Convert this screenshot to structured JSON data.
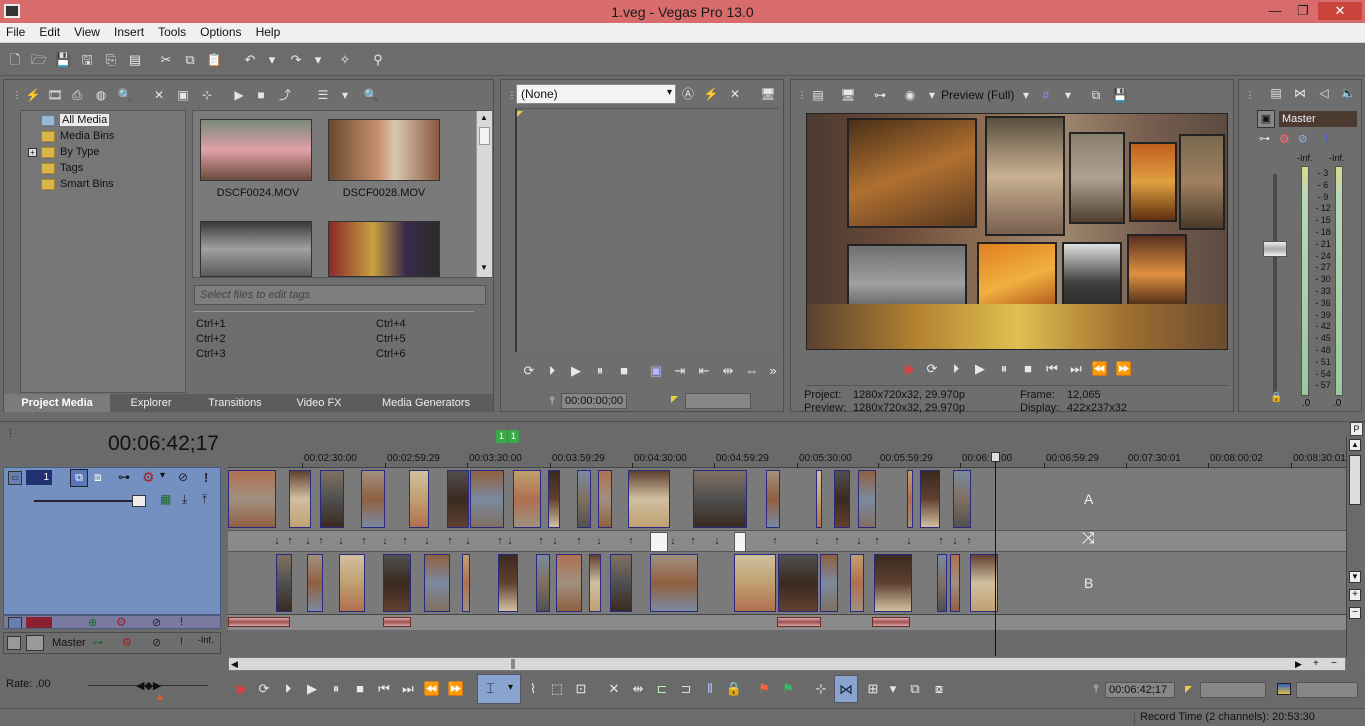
{
  "window": {
    "title": "1.veg - Vegas Pro 13.0",
    "minimize": "—",
    "maximize": "❐",
    "close": "✕"
  },
  "menu": [
    "File",
    "Edit",
    "View",
    "Insert",
    "Tools",
    "Options",
    "Help"
  ],
  "project_media": {
    "tree": [
      "All Media",
      "Media Bins",
      "By Type",
      "Tags",
      "Smart Bins"
    ],
    "expand_glyph": "+",
    "files": [
      "DSCF0024.MOV",
      "DSCF0028.MOV"
    ],
    "tag_placeholder": "Select files to edit tags",
    "shortcuts": [
      "Ctrl+1",
      "Ctrl+4",
      "Ctrl+2",
      "Ctrl+5",
      "Ctrl+3",
      "Ctrl+6"
    ]
  },
  "tabs": [
    "Project Media",
    "Explorer",
    "Transitions",
    "Video FX",
    "Media Generators"
  ],
  "trimmer": {
    "select_value": "(None)",
    "timecode": "00:00:00;00"
  },
  "preview": {
    "mode": "Preview (Full)",
    "project_label": "Project:",
    "project_value": "1280x720x32, 29.970p",
    "preview_label": "Preview:",
    "preview_value": "1280x720x32, 29.970p",
    "frame_label": "Frame:",
    "frame_value": "12,065",
    "display_label": "Display:",
    "display_value": "422x237x32"
  },
  "master": {
    "label": "Master",
    "inf_left": "-Inf.",
    "inf_right": "-Inf.",
    "scale": [
      "3",
      "6",
      "9",
      "12",
      "15",
      "18",
      "21",
      "24",
      "27",
      "30",
      "33",
      "36",
      "39",
      "42",
      "45",
      "48",
      "51",
      "54",
      "57"
    ],
    "bottom_left": ".0",
    "bottom_right": ".0"
  },
  "timeline": {
    "timecode": "00:06:42;17",
    "markers": [
      "1",
      "1"
    ],
    "ruler": [
      "00:02:30:00",
      "00:02:59:29",
      "00:03:30:00",
      "00:03:59:29",
      "00:04:30:00",
      "00:04:59:29",
      "00:05:30:00",
      "00:05:59:29",
      "00:06:",
      "00:06:59:29",
      "00:07:30:01",
      "00:08:00:02",
      "00:08:30:01"
    ],
    "ruler_playhead_suffix": "00",
    "track_number": "1",
    "letter_a": "A",
    "letter_b": "B",
    "transition_glyph": "⤨",
    "master_label": "Master",
    "master_inf": "-Inf."
  },
  "bottom": {
    "rate_label": "Rate: .00",
    "timecode": "00:06:42;17",
    "record_time": "Record Time (2 channels): 20:53:30"
  },
  "colors": {
    "titlebar": "#d86c6c",
    "menubar": "#f0f0f0",
    "panel": "#6e6e6e",
    "trackhead": "#7390c0"
  }
}
